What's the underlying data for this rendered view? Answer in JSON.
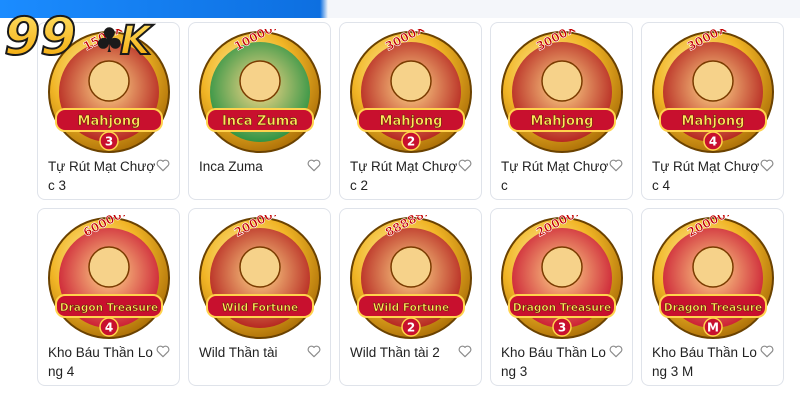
{
  "brand": {
    "logo_text": "99OK",
    "accent": "#f5b400",
    "logo_color": "#1a1a1a"
  },
  "section": {
    "heading": ""
  },
  "games": [
    {
      "title": "Tự Rút Mạt Chược 3",
      "multiplier": "1500X",
      "art_text": "Mahjong",
      "art_sub": "3",
      "art_color": "#b01818",
      "favorite_icon": "heart-outline-icon"
    },
    {
      "title": "Inca Zuma",
      "multiplier": "10000X",
      "art_text": "Inca Zuma",
      "art_sub": "",
      "art_color": "#1e8e3e",
      "favorite_icon": "heart-outline-icon"
    },
    {
      "title": "Tự Rút Mạt Chược 2",
      "multiplier": "3000X",
      "art_text": "Mahjong",
      "art_sub": "2",
      "art_color": "#b01818",
      "favorite_icon": "heart-outline-icon"
    },
    {
      "title": "Tự Rút Mạt Chược",
      "multiplier": "3000X",
      "art_text": "Mahjong",
      "art_sub": "",
      "art_color": "#b01818",
      "favorite_icon": "heart-outline-icon"
    },
    {
      "title": "Tự Rút Mạt Chược 4",
      "multiplier": "3000X",
      "art_text": "Mahjong",
      "art_sub": "4",
      "art_color": "#b01818",
      "favorite_icon": "heart-outline-icon"
    },
    {
      "title": "Kho Báu Thần Long 4",
      "multiplier": "60000X",
      "art_text": "Dragon Treasure",
      "art_sub": "4",
      "art_color": "#c8102e",
      "favorite_icon": "heart-outline-icon"
    },
    {
      "title": "Wild Thần tài",
      "multiplier": "20000X",
      "art_text": "Wild Fortune",
      "art_sub": "",
      "art_color": "#b01818",
      "favorite_icon": "heart-outline-icon"
    },
    {
      "title": "Wild Thần tài 2",
      "multiplier": "88888X",
      "art_text": "Wild Fortune",
      "art_sub": "2",
      "art_color": "#b01818",
      "favorite_icon": "heart-outline-icon"
    },
    {
      "title": "Kho Báu Thần Long 3",
      "multiplier": "20000X",
      "art_text": "Dragon Treasure",
      "art_sub": "3",
      "art_color": "#c8102e",
      "favorite_icon": "heart-outline-icon"
    },
    {
      "title": "Kho Báu Thần Long 3 M",
      "multiplier": "20000X",
      "art_text": "Dragon Treasure",
      "art_sub": "M",
      "art_color": "#c8102e",
      "favorite_icon": "heart-outline-icon"
    }
  ]
}
